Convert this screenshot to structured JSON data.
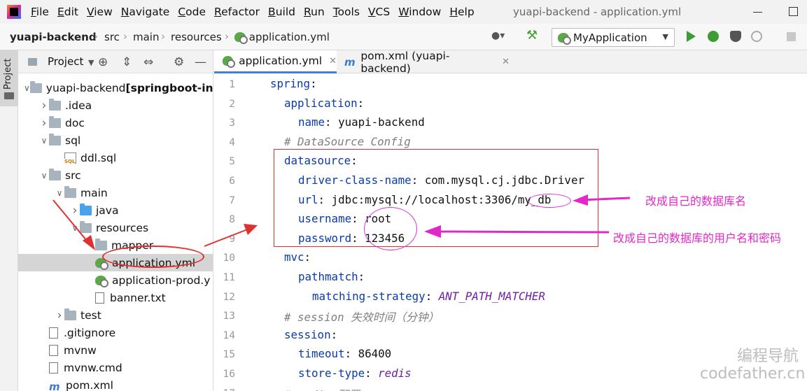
{
  "menubar": {
    "items": [
      "File",
      "Edit",
      "View",
      "Navigate",
      "Code",
      "Refactor",
      "Build",
      "Run",
      "Tools",
      "VCS",
      "Window",
      "Help"
    ],
    "window_title": "yuapi-backend - application.yml"
  },
  "breadcrumb": [
    "yuapi-backend",
    "src",
    "main",
    "resources",
    "application.yml"
  ],
  "toolbar": {
    "run_config": "MyApplication"
  },
  "left_strip": {
    "label": "Project"
  },
  "project_panel": {
    "title": "Project",
    "tree": [
      {
        "label": "yuapi-backend",
        "suffix": "[springboot-ini",
        "kind": "module",
        "indent": 0,
        "expanded": true
      },
      {
        "label": ".idea",
        "kind": "folder",
        "indent": 1,
        "expanded": false
      },
      {
        "label": "doc",
        "kind": "folder",
        "indent": 1,
        "expanded": false
      },
      {
        "label": "sql",
        "kind": "folder",
        "indent": 1,
        "expanded": true
      },
      {
        "label": "ddl.sql",
        "kind": "sql",
        "indent": 2
      },
      {
        "label": "src",
        "kind": "folder",
        "indent": 1,
        "expanded": true
      },
      {
        "label": "main",
        "kind": "folder",
        "indent": 2,
        "expanded": true
      },
      {
        "label": "java",
        "kind": "folder-blue",
        "indent": 3,
        "expanded": false
      },
      {
        "label": "resources",
        "kind": "folder",
        "indent": 3,
        "expanded": true
      },
      {
        "label": "mapper",
        "kind": "folder",
        "indent": 4
      },
      {
        "label": "application.yml",
        "kind": "yml",
        "indent": 4,
        "selected": true
      },
      {
        "label": "application-prod.y",
        "kind": "yml",
        "indent": 4
      },
      {
        "label": "banner.txt",
        "kind": "file",
        "indent": 4
      },
      {
        "label": "test",
        "kind": "folder",
        "indent": 2,
        "expanded": false
      },
      {
        "label": ".gitignore",
        "kind": "file",
        "indent": 1
      },
      {
        "label": "mvnw",
        "kind": "file",
        "indent": 1
      },
      {
        "label": "mvnw.cmd",
        "kind": "file",
        "indent": 1
      },
      {
        "label": "pom.xml",
        "kind": "maven",
        "indent": 1
      }
    ]
  },
  "editor": {
    "tabs": [
      {
        "label": "application.yml",
        "active": true,
        "icon": "yml-icon"
      },
      {
        "label": "pom.xml (yuapi-backend)",
        "active": false,
        "icon": "maven-icon"
      }
    ],
    "lines": [
      {
        "n": "1",
        "indent": 0,
        "key": "spring",
        "val": "",
        "fold": true
      },
      {
        "n": "2",
        "indent": 1,
        "key": "application",
        "val": "",
        "fold": true
      },
      {
        "n": "3",
        "indent": 2,
        "key": "name",
        "val": "yuapi-backend",
        "fold": true
      },
      {
        "n": "4",
        "indent": 1,
        "comment": "# DataSource Config"
      },
      {
        "n": "5",
        "indent": 1,
        "key": "datasource",
        "val": "",
        "fold": true
      },
      {
        "n": "6",
        "indent": 2,
        "key": "driver-class-name",
        "val": "com.mysql.cj.jdbc.Driver"
      },
      {
        "n": "7",
        "indent": 2,
        "key": "url",
        "val": "jdbc:mysql://localhost:3306/my_db"
      },
      {
        "n": "8",
        "indent": 2,
        "key": "username",
        "val": "root"
      },
      {
        "n": "9",
        "indent": 2,
        "key": "password",
        "val": "123456",
        "fold": true
      },
      {
        "n": "10",
        "indent": 1,
        "key": "mvc",
        "val": "",
        "fold": true
      },
      {
        "n": "11",
        "indent": 2,
        "key": "pathmatch",
        "val": "",
        "fold": true
      },
      {
        "n": "12",
        "indent": 3,
        "key": "matching-strategy",
        "kw": "ANT_PATH_MATCHER",
        "fold": true
      },
      {
        "n": "13",
        "indent": 1,
        "comment": "# session 失效时间（分钟）"
      },
      {
        "n": "14",
        "indent": 1,
        "key": "session",
        "val": "",
        "fold": true
      },
      {
        "n": "15",
        "indent": 2,
        "key": "timeout",
        "val": "86400"
      },
      {
        "n": "16",
        "indent": 2,
        "key": "store-type",
        "kw": "redis",
        "fold": true
      },
      {
        "n": "17",
        "indent": 1,
        "comment": "# redis 配置"
      }
    ]
  },
  "annotations": {
    "note_db_name": "改成自己的数据库名",
    "note_user_pass": "改成自己的数据库的用户名和密码",
    "accent": "#e328c9",
    "box_color": "#e03030"
  },
  "watermark": {
    "line1": "编程导航",
    "line2": "codefather.cn"
  }
}
